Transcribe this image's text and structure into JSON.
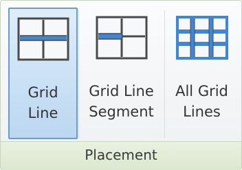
{
  "ribbon_panel": {
    "buttons": [
      {
        "icon": "grid-line-icon",
        "line1": "Grid",
        "line2": "Line",
        "selected": true
      },
      {
        "icon": "grid-line-segment-icon",
        "line1": "Grid Line",
        "line2": "Segment",
        "selected": false
      },
      {
        "icon": "all-grid-lines-icon",
        "line1": "All Grid",
        "line2": "Lines",
        "selected": false
      }
    ],
    "group_label": "Placement"
  }
}
